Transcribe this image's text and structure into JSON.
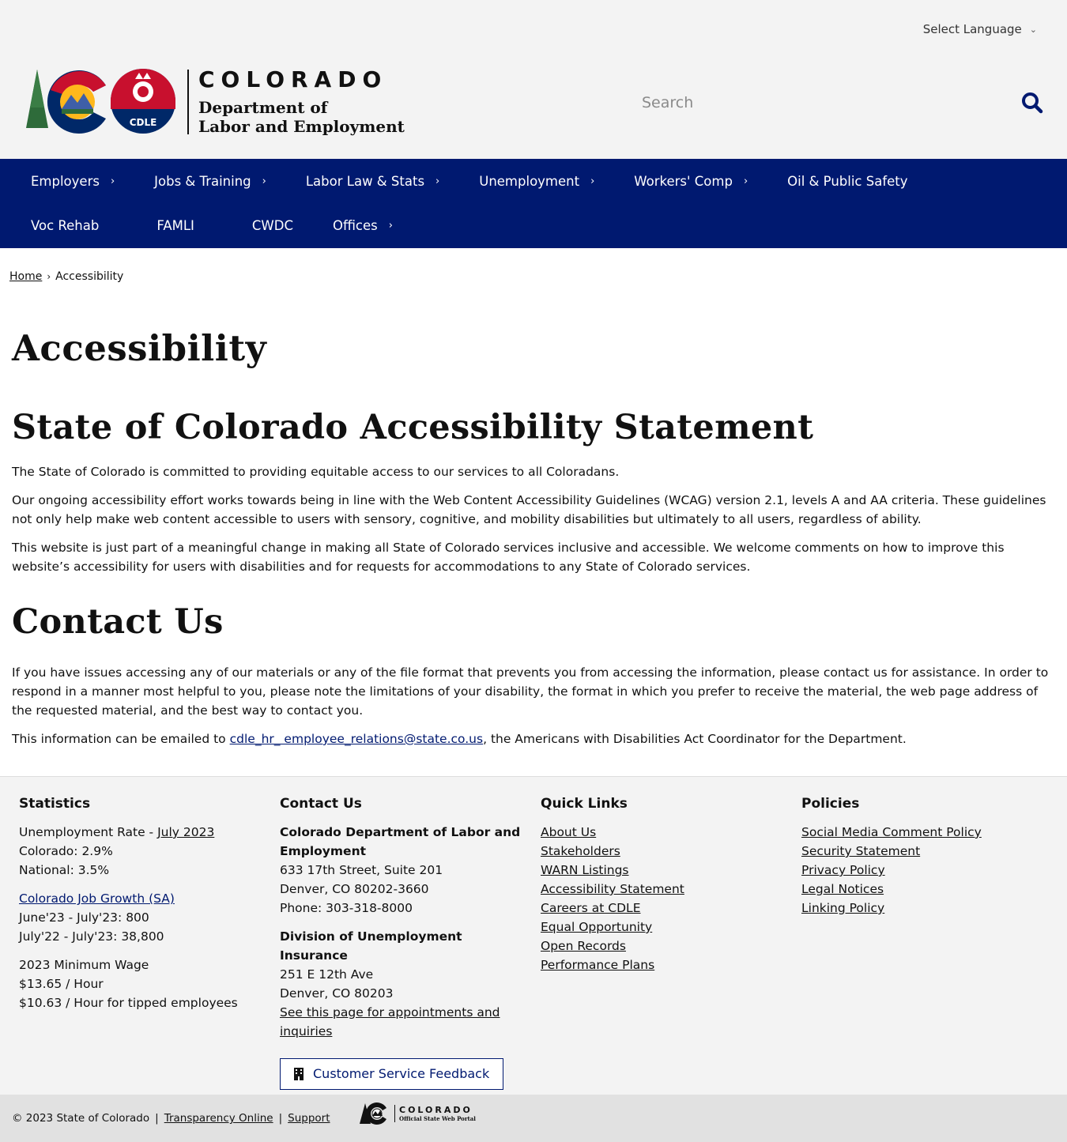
{
  "header": {
    "language": "Select Language",
    "logo": {
      "state": "COLORADO",
      "dept_line1": "Department of",
      "dept_line2": "Labor and Employment",
      "badge": "CDLE"
    },
    "search_placeholder": "Search"
  },
  "nav": {
    "items": [
      {
        "label": "Employers",
        "has_submenu": true
      },
      {
        "label": "Jobs & Training",
        "has_submenu": true
      },
      {
        "label": "Labor Law & Stats",
        "has_submenu": true
      },
      {
        "label": "Unemployment",
        "has_submenu": true
      },
      {
        "label": "Workers' Comp",
        "has_submenu": true
      },
      {
        "label": "Oil & Public Safety",
        "has_submenu": false
      },
      {
        "label": "Voc Rehab",
        "has_submenu": false
      },
      {
        "label": "FAMLI",
        "has_submenu": false
      },
      {
        "label": "CWDC",
        "has_submenu": false
      },
      {
        "label": "Offices",
        "has_submenu": true
      }
    ]
  },
  "breadcrumb": {
    "home": "Home",
    "current": "Accessibility"
  },
  "page": {
    "title": "Accessibility",
    "section1": {
      "heading": "State of Colorado Accessibility Statement",
      "p1": "The State of Colorado is committed to providing equitable access to our services to all Coloradans.",
      "p2": "Our ongoing accessibility effort works towards being in line with the Web Content Accessibility Guidelines (WCAG) version 2.1, levels A and AA criteria. These guidelines not only help make web content accessible to users with sensory, cognitive, and mobility disabilities but ultimately to all users, regardless of ability.",
      "p3": "This website is just part of a meaningful change in making all State of Colorado services inclusive and accessible. We welcome comments on how to improve this website’s accessibility for users with disabilities and for requests for accommodations to any State of Colorado services."
    },
    "section2": {
      "heading": "Contact Us",
      "p1": "If you have issues accessing any of our materials or any of the file format that prevents you from accessing the information, please contact us for assistance. In order to respond in a manner most helpful to you, please note the limitations of your disability, the format in which you prefer to receive the material, the web page address of the requested material, and the best way to contact you.",
      "p2_before": "This information can be emailed to ",
      "email": "cdle_hr_ employee_relations@state.co.us",
      "p2_after": ", the Americans with Disabilities Act Coordinator for the Department."
    }
  },
  "footer": {
    "statistics": {
      "heading": "Statistics",
      "unemp_label": "Unemployment Rate - ",
      "unemp_link": "July 2023",
      "colorado": "Colorado: 2.9%",
      "national": "National: 3.5%",
      "job_growth_link": "Colorado Job Growth (SA)",
      "growth1": "June'23 - July'23: 800",
      "growth2": "July'22 - July'23: 38,800",
      "min_wage_label": "2023 Minimum Wage",
      "min_wage1": "$13.65 / Hour",
      "min_wage2": "$10.63 / Hour for tipped employees"
    },
    "contact": {
      "heading": "Contact Us",
      "org": "Colorado Department of Labor and Employment",
      "addr1": "633 17th Street, Suite 201",
      "addr2": "Denver, CO  80202-3660",
      "phone": "Phone: 303-318-8000",
      "div": "Division of Unemployment Insurance",
      "div_addr1": "251 E 12th Ave",
      "div_addr2": "Denver, CO  80203",
      "appt_link": "See this page for appointments and inquiries",
      "feedback_button": "Customer Service Feedback"
    },
    "quick_links": {
      "heading": "Quick Links",
      "items": [
        "About Us",
        "Stakeholders",
        "WARN Listings",
        "Accessibility Statement",
        "Careers at CDLE",
        "Equal Opportunity",
        "Open Records",
        "Performance Plans"
      ]
    },
    "policies": {
      "heading": "Policies",
      "items": [
        "Social Media Comment Policy",
        "Security Statement",
        "Privacy Policy",
        "Legal Notices",
        "Linking Policy"
      ]
    }
  },
  "bottom": {
    "copyright": "© 2023 State of Colorado",
    "transparency": "Transparency Online",
    "support": "Support",
    "portal_line1": "COLORADO",
    "portal_line2": "Official State Web Portal"
  },
  "colors": {
    "nav_bg": "#001970",
    "logo_red": "#c8102e",
    "logo_blue": "#002868",
    "logo_gold": "#ffb81c",
    "tree_green": "#2e6b3a"
  }
}
